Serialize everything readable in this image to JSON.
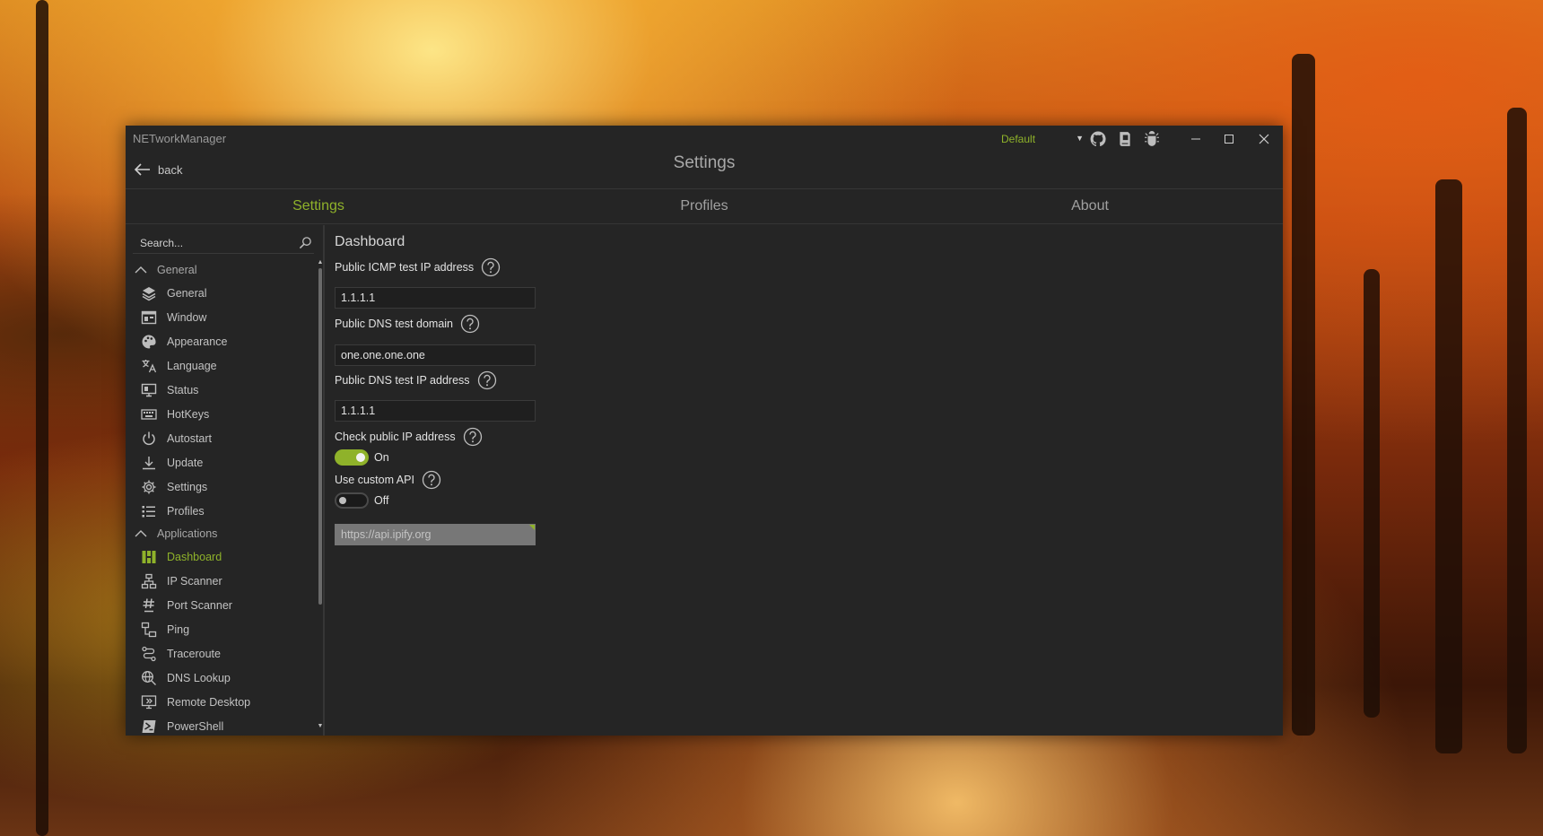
{
  "window": {
    "app_title": "NETworkManager",
    "page_title": "Settings",
    "back_label": "back",
    "profile_selected": "Default"
  },
  "tabs": [
    {
      "label": "Settings",
      "active": true
    },
    {
      "label": "Profiles",
      "active": false
    },
    {
      "label": "About",
      "active": false
    }
  ],
  "sidebar": {
    "search_placeholder": "Search...",
    "groups": [
      {
        "label": "General",
        "items": [
          {
            "label": "General",
            "icon": "layers-icon"
          },
          {
            "label": "Window",
            "icon": "window-icon"
          },
          {
            "label": "Appearance",
            "icon": "palette-icon"
          },
          {
            "label": "Language",
            "icon": "translate-icon"
          },
          {
            "label": "Status",
            "icon": "monitor-icon"
          },
          {
            "label": "HotKeys",
            "icon": "keyboard-icon"
          },
          {
            "label": "Autostart",
            "icon": "power-icon"
          },
          {
            "label": "Update",
            "icon": "download-icon"
          },
          {
            "label": "Settings",
            "icon": "gear-icon"
          },
          {
            "label": "Profiles",
            "icon": "list-icon"
          }
        ]
      },
      {
        "label": "Applications",
        "items": [
          {
            "label": "Dashboard",
            "icon": "dashboard-icon",
            "active": true
          },
          {
            "label": "IP Scanner",
            "icon": "network-icon"
          },
          {
            "label": "Port Scanner",
            "icon": "hash-icon"
          },
          {
            "label": "Ping",
            "icon": "ping-icon"
          },
          {
            "label": "Traceroute",
            "icon": "route-icon"
          },
          {
            "label": "DNS Lookup",
            "icon": "globe-search-icon"
          },
          {
            "label": "Remote Desktop",
            "icon": "remote-desktop-icon"
          },
          {
            "label": "PowerShell",
            "icon": "powershell-icon"
          }
        ]
      }
    ]
  },
  "content": {
    "section_title": "Dashboard",
    "icmp_label": "Public ICMP test IP address",
    "icmp_value": "1.1.1.1",
    "dns_domain_label": "Public DNS test domain",
    "dns_domain_value": "one.one.one.one",
    "dns_ip_label": "Public DNS test IP address",
    "dns_ip_value": "1.1.1.1",
    "check_ip_label": "Check public IP address",
    "check_ip_state": "On",
    "custom_api_label": "Use custom API",
    "custom_api_state": "Off",
    "custom_api_url": "https://api.ipify.org"
  },
  "colors": {
    "accent": "#8fb22a",
    "window_bg": "#252525"
  }
}
